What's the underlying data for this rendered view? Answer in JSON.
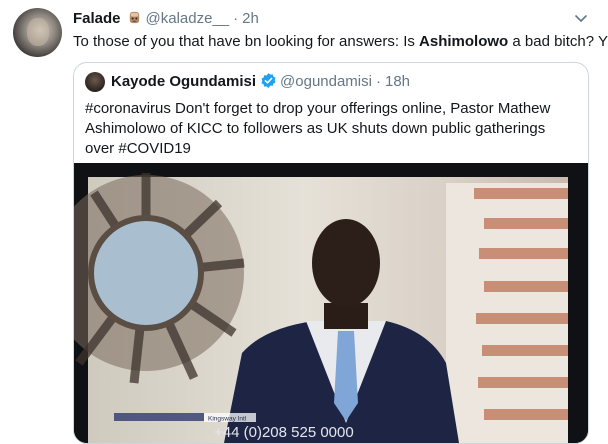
{
  "tweet": {
    "display_name": "Falade",
    "handle": "@kaladze__",
    "separator": "·",
    "time": "2h",
    "text_before": "To those of you that have bn looking for answers: Is ",
    "text_bold": "Ashimolowo",
    "text_after": " a bad bitch? YES",
    "icons": {
      "avatar": "profile-photo",
      "badge": "emoji-badge",
      "menu": "chevron-down-icon"
    }
  },
  "quoted_tweet": {
    "display_name": "Kayode Ogundamisi",
    "handle": "@ogundamisi",
    "separator": "·",
    "time": "18h",
    "text": "#coronavirus Don't forget to drop your offerings online, Pastor Mathew Ashimolowo of  KICC to followers as UK shuts down public gatherings over #COVID19",
    "icons": {
      "avatar": "profile-photo",
      "verified": "verified-badge-icon"
    },
    "video": {
      "overlay_text": "+44 (0)208 525 0000",
      "caption_text": "Kingsway Intl"
    }
  },
  "colors": {
    "text": "#14171a",
    "secondary": "#657786",
    "verified": "#1da1f2",
    "border": "#ccd6dd"
  }
}
